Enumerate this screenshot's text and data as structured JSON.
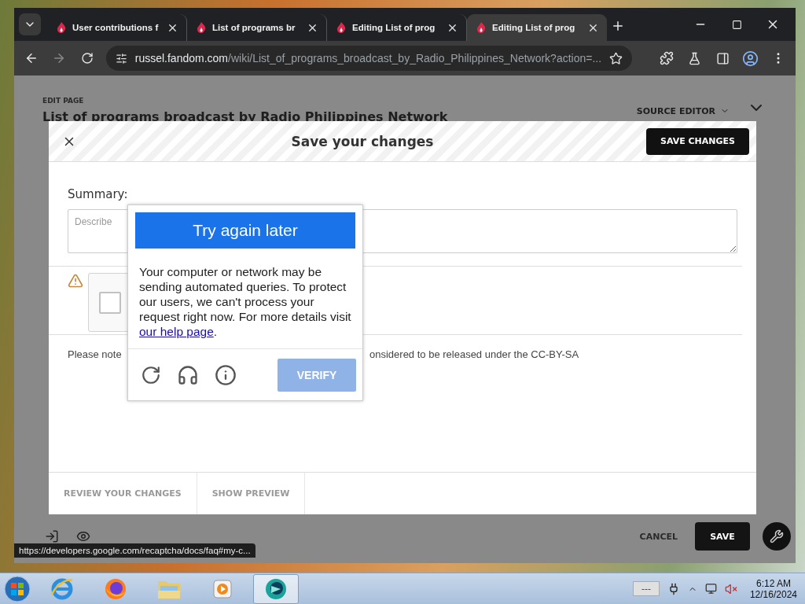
{
  "browser": {
    "tabs": [
      {
        "title": "User contributions f",
        "selected": false
      },
      {
        "title": "List of programs br",
        "selected": false
      },
      {
        "title": "Editing List of prog",
        "selected": false
      },
      {
        "title": "Editing List of prog",
        "selected": true
      }
    ],
    "address": {
      "host": "russel.fandom.com",
      "path": "/wiki/List_of_programs_broadcast_by_Radio_Philippines_Network?action=..."
    }
  },
  "page": {
    "eyebrow": "EDIT PAGE",
    "title": "List of programs broadcast by Radio Philippines Network",
    "editor_mode": "SOURCE EDITOR",
    "cancel": "CANCEL",
    "save": "SAVE"
  },
  "dialog": {
    "title": "Save your changes",
    "primary": "SAVE CHANGES",
    "summary_label": "Summary:",
    "summary_placeholder": "Describe",
    "captcha_checked": false,
    "notice_start": "Please note",
    "notice_end": "onsidered to be released under the CC-BY-SA",
    "footer_tabs": [
      {
        "label": "REVIEW YOUR CHANGES"
      },
      {
        "label": "SHOW PREVIEW"
      }
    ]
  },
  "captcha": {
    "heading": "Try again later",
    "message": "Your computer or network may be sending automated queries. To protect our users, we can't process your request right now. For more details visit ",
    "link": "our help page",
    "message_end": ".",
    "verify": {
      "label": "VERIFY",
      "disabled": true
    }
  },
  "status_url": "https://developers.google.com/recaptcha/docs/faq#my-c...",
  "taskbar": {
    "apps": [
      {
        "kind": "globe",
        "selected": false
      },
      {
        "kind": "fox",
        "selected": false
      },
      {
        "kind": "folder",
        "selected": false
      },
      {
        "kind": "player",
        "selected": false
      },
      {
        "kind": "chat",
        "selected": true
      }
    ],
    "battery": "---",
    "time": "6:12 AM",
    "date": "12/16/2024"
  }
}
